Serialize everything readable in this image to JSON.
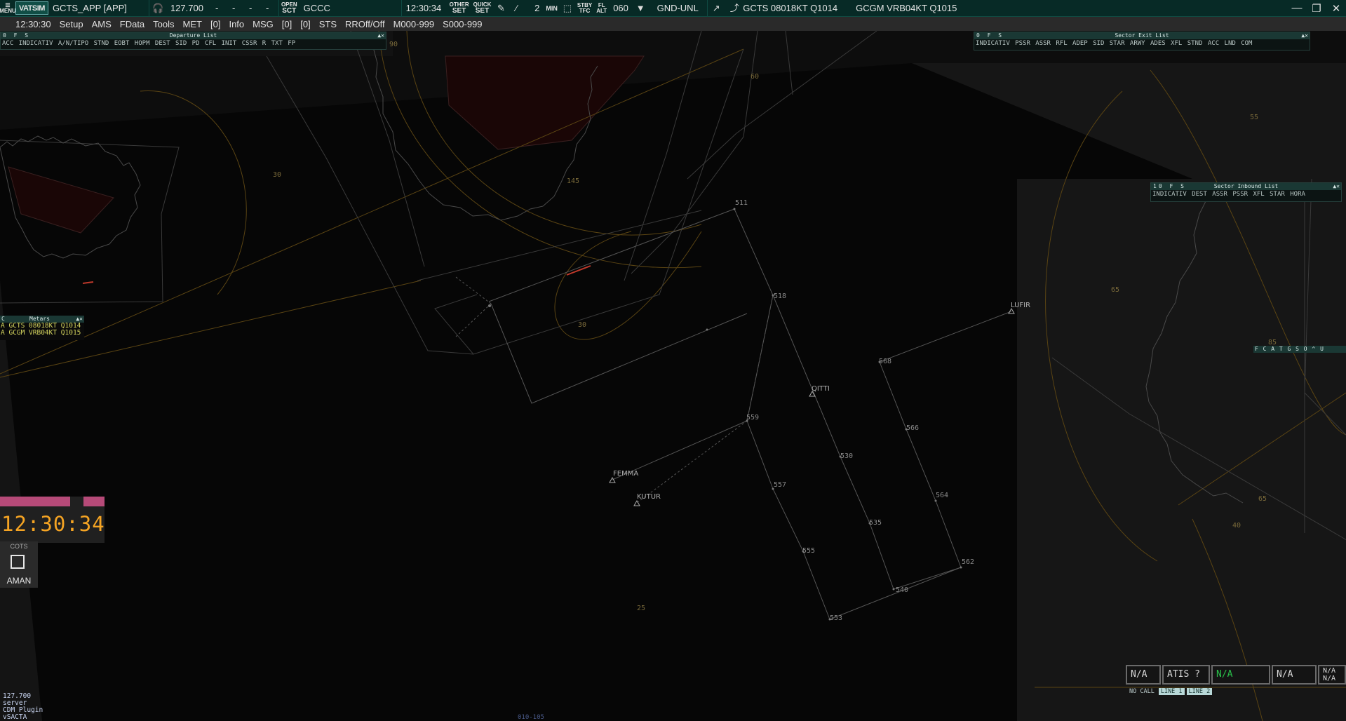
{
  "toolbar": {
    "menu_label": "MENU",
    "logo": "VATSIM",
    "title": "GCTS_APP [APP]",
    "frequency": "127.700",
    "dashes": [
      "-",
      "-",
      "-",
      "-"
    ],
    "open_sct_top": "OPEN",
    "open_sct_bottom": "SCT",
    "sector": "GCCC",
    "time": "12:30:34",
    "other_set_top": "OTHER",
    "other_set_bottom": "SET",
    "quick_set_top": "QUICK",
    "quick_set_bottom": "SET",
    "count": "2",
    "min_label": "MIN",
    "stby_top": "STBY",
    "stby_bottom": "TFC",
    "fl_top": "FL",
    "fl_bottom": "ALT",
    "fl_value": "060",
    "gnd": "GND-UNL",
    "metar1": "GCTS 08018KT Q1014",
    "metar2": "GCGM VRB04KT Q1015"
  },
  "menubar": {
    "clock": "12:30:30",
    "items": [
      "Setup",
      "AMS",
      "FData",
      "Tools",
      "MET",
      "[0]",
      "Info",
      "MSG",
      "[0]",
      "[0]",
      "STS",
      "RROff/Off",
      "M000-999",
      "S000-999"
    ]
  },
  "departure_list": {
    "flags": "0 F S",
    "title": "Departure List",
    "columns": "ACC INDICATIV A/N/TIPO STND EOBT HOPM DEST   SID    PD   CFL  INIT CSSR R    TXT     FP"
  },
  "sector_exit_list": {
    "flags": "0 F S",
    "title": "Sector Exit List",
    "columns": "INDICATIV PSSR ASSR RFL  ADEP   SID     STAR  ARWY ADES XFL STND  ACC  LND COM"
  },
  "sector_inbound_list": {
    "flags": "10 F S",
    "title": "Sector Inbound List",
    "columns": "INDICATIV DEST ASSR PSSR  XFL   STAR  HORA"
  },
  "metars": {
    "flag": "C",
    "title": "Metars",
    "lines": [
      "A GCTS 08018KT Q1014",
      "A GCGM VRB04KT Q1015"
    ]
  },
  "big_clock": {
    "time": "12:30:34"
  },
  "aman": {
    "cots": "COTS",
    "label": "AMAN"
  },
  "bottom_info": [
    "127.700",
    "server",
    "CDM Plugin",
    "vSACTA"
  ],
  "atis": {
    "na1": "N/A",
    "atis": "ATIS ?",
    "na2": "N/A",
    "na3": "N/A",
    "na4a": "N/A",
    "na4b": "N/A"
  },
  "lines": {
    "nocall": "NO CALL",
    "line1": "LINE 1",
    "line2": "LINE 2"
  },
  "fcat_bar": "F C A T G S O ^ U",
  "map_labels": {
    "alt_90": "90",
    "alt_60": "60",
    "alt_30a": "30",
    "alt_145": "145",
    "alt_30b": "30",
    "alt_55": "55",
    "alt_65a": "65",
    "alt_85": "85",
    "alt_65b": "65",
    "alt_40": "40",
    "alt_25": "25",
    "range": "010-105"
  },
  "waypoints": {
    "wp511": "511",
    "wp518": "518",
    "wp568": "568",
    "wp566": "566",
    "wp559": "559",
    "wp557": "557",
    "wp530": "530",
    "wp535": "535",
    "wp564": "564",
    "wp555": "555",
    "wp562": "562",
    "wp540": "540",
    "wp553": "553"
  },
  "fixes": {
    "lufir": "LUFIR",
    "qitti": "QITTI",
    "femma": "FEMMA",
    "kutur": "KUTUR"
  },
  "colors": {
    "toolbar": "#072a26",
    "clock": "#f5a423",
    "clock_bar": "#b64a78",
    "metar_text": "#d8d860",
    "atis_green": "#29c24a"
  }
}
